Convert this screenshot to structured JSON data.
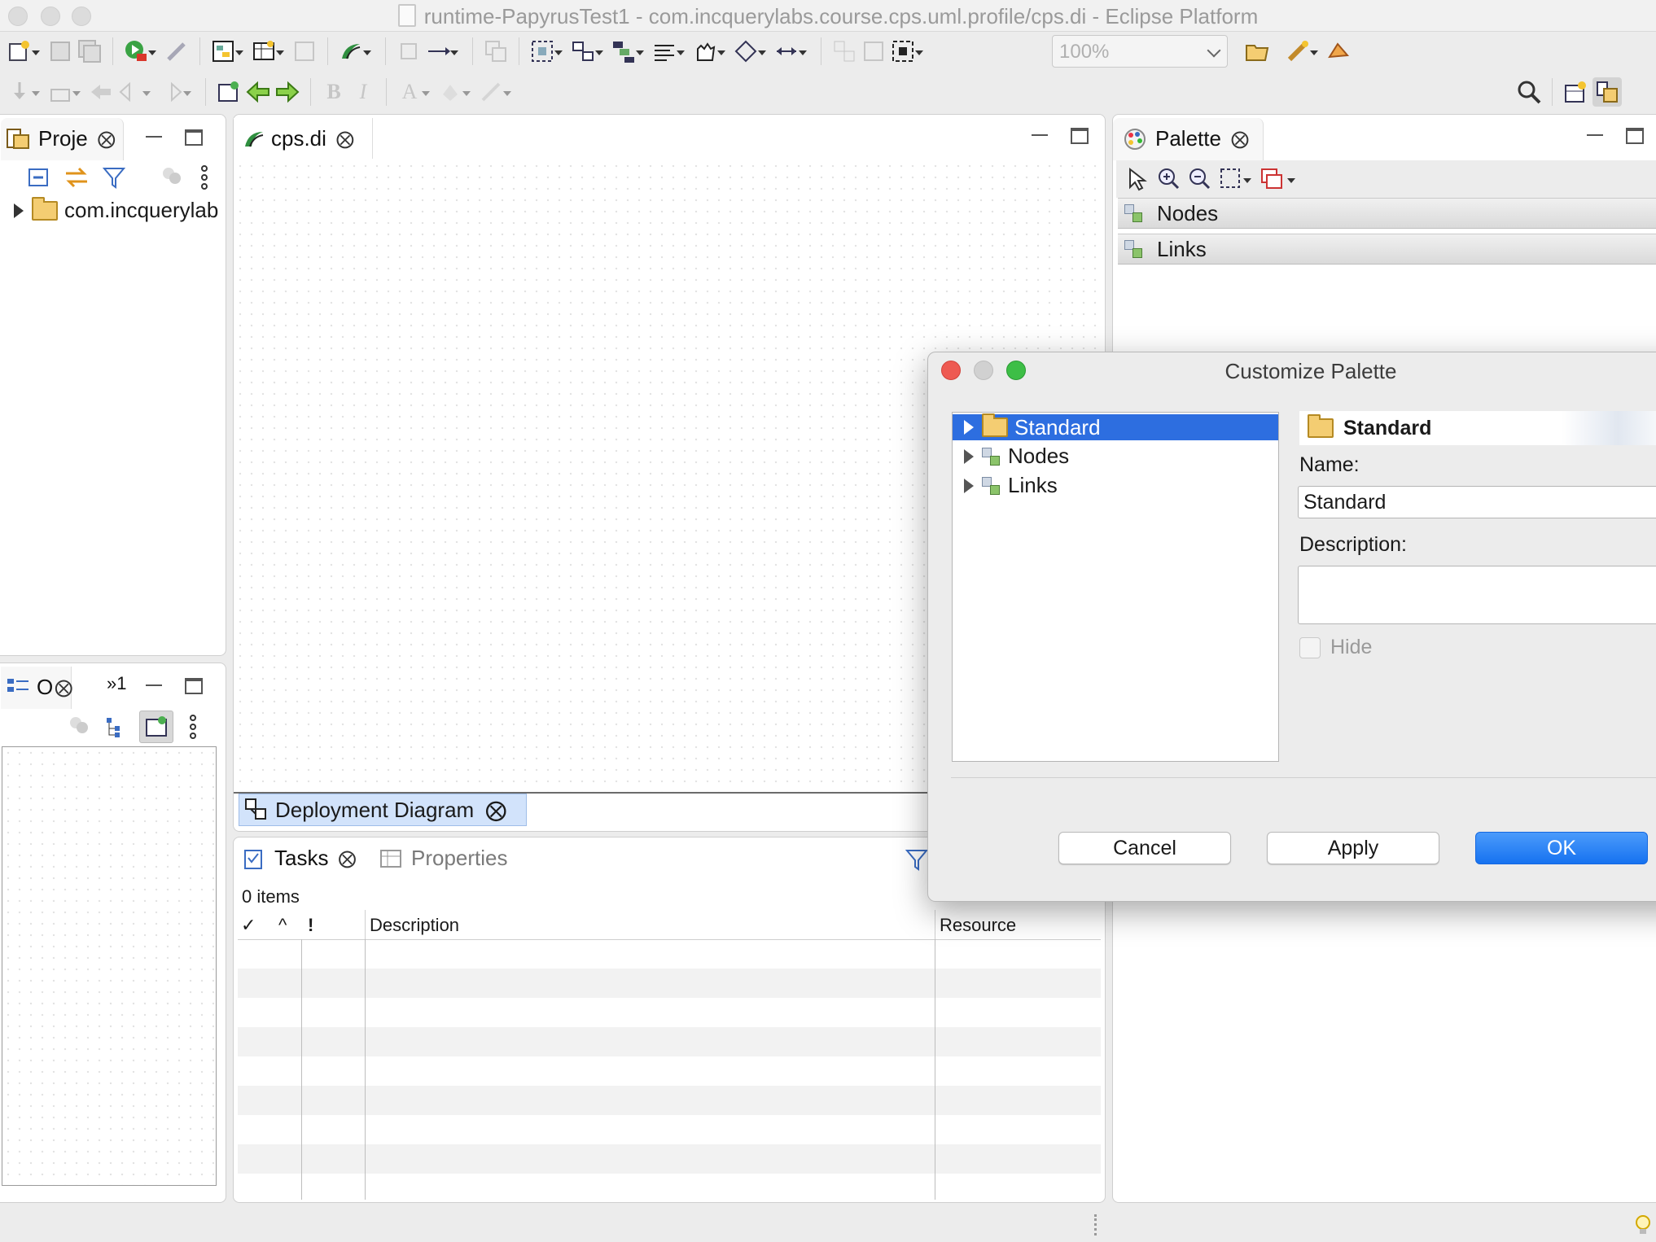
{
  "window": {
    "title": "runtime-PapyrusTest1 - com.incquerylabs.course.cps.uml.profile/cps.di - Eclipse Platform"
  },
  "toolbar": {
    "zoom_value": "100%",
    "bold": "B",
    "italic": "I",
    "font_color": "A"
  },
  "project_explorer": {
    "tab_label": "Proje",
    "tree": [
      {
        "label": "com.incquerylab"
      }
    ]
  },
  "outline": {
    "tab_label": "O",
    "overflow_label": "»1"
  },
  "editor": {
    "tab_label": "cps.di",
    "diagram_tab_label": "Deployment Diagram"
  },
  "palette": {
    "tab_label": "Palette",
    "drawers": [
      {
        "label": "Nodes"
      },
      {
        "label": "Links"
      }
    ]
  },
  "tasks": {
    "tab_label": "Tasks",
    "properties_tab_label": "Properties",
    "count_text": "0 items",
    "columns": {
      "done": "✓",
      "priority": "^",
      "flag": "!",
      "description": "Description",
      "resource": "Resource"
    }
  },
  "dialog": {
    "title": "Customize Palette",
    "tree": [
      {
        "label": "Standard"
      },
      {
        "label": "Nodes"
      },
      {
        "label": "Links"
      }
    ],
    "header": "Standard",
    "name_label": "Name:",
    "name_value": "Standard",
    "description_label": "Description:",
    "description_value": "",
    "hide_label": "Hide",
    "buttons": {
      "cancel": "Cancel",
      "apply": "Apply",
      "ok": "OK"
    }
  },
  "colors": {
    "selection": "#2d6ee0",
    "ok_button": "#1672f0",
    "close_red": "#ee5a52",
    "zoom_green": "#3dbe46"
  }
}
